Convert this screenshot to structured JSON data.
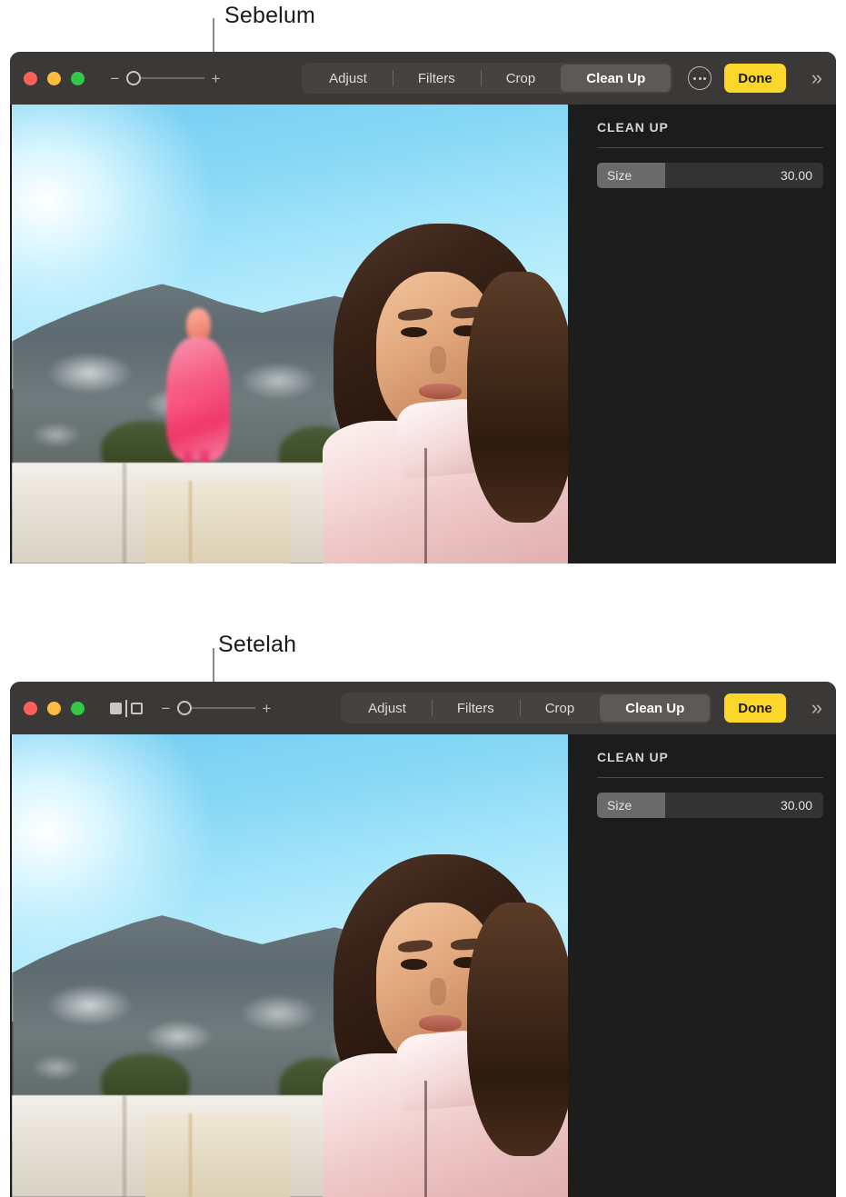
{
  "callouts": [
    {
      "label": "Sebelum"
    },
    {
      "label": "Setelah"
    }
  ],
  "windows": [
    {
      "id": "before",
      "traffic_lights": [
        {
          "name": "close",
          "color": "#fc6058"
        },
        {
          "name": "minimize",
          "color": "#fdbc40"
        },
        {
          "name": "zoom",
          "color": "#34c749"
        }
      ],
      "has_compare_icon": false,
      "zoom_slider": {
        "minus": "−",
        "plus": "+",
        "value": 0
      },
      "tabs": [
        {
          "label": "Adjust",
          "active": false
        },
        {
          "label": "Filters",
          "active": false
        },
        {
          "label": "Crop",
          "active": false
        },
        {
          "label": "Clean Up",
          "active": true
        }
      ],
      "has_more_button": true,
      "done_label": "Done",
      "chevrons": "»",
      "sidebar": {
        "title": "CLEAN UP",
        "size_label": "Size",
        "size_value": "30.00",
        "size_percent": 30
      },
      "photo": {
        "shows_removed_person": true
      }
    },
    {
      "id": "after",
      "traffic_lights": [
        {
          "name": "close",
          "color": "#fc6058"
        },
        {
          "name": "minimize",
          "color": "#fdbc40"
        },
        {
          "name": "zoom",
          "color": "#34c749"
        }
      ],
      "has_compare_icon": true,
      "zoom_slider": {
        "minus": "−",
        "plus": "+",
        "value": 0
      },
      "tabs": [
        {
          "label": "Adjust",
          "active": false
        },
        {
          "label": "Filters",
          "active": false
        },
        {
          "label": "Crop",
          "active": false
        },
        {
          "label": "Clean Up",
          "active": true
        }
      ],
      "has_more_button": false,
      "done_label": "Done",
      "chevrons": "»",
      "sidebar": {
        "title": "CLEAN UP",
        "size_label": "Size",
        "size_value": "30.00",
        "size_percent": 30
      },
      "photo": {
        "shows_removed_person": false
      }
    }
  ],
  "colors": {
    "toolbar_bg": "#3b3937",
    "sidebar_bg": "#1c1c1c",
    "accent_done": "#fcd72a",
    "tab_active_bg": "#5c5956"
  }
}
